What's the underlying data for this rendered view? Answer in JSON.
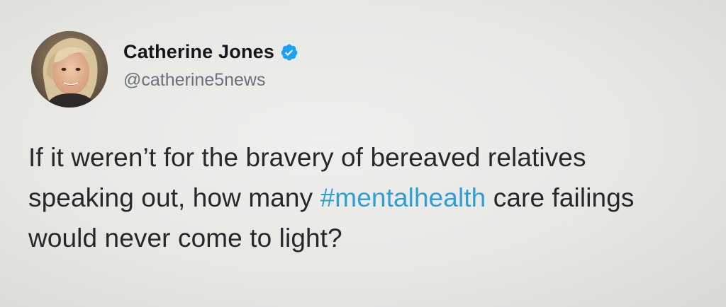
{
  "tweet": {
    "author": {
      "display_name": "Catherine Jones",
      "handle": "@catherine5news",
      "verified": true,
      "avatar_icon": "profile-photo-icon",
      "verified_icon": "verified-badge-icon"
    },
    "text_lines": [
      {
        "before": "If it weren’t for the bravery of bereaved relatives",
        "hashtag": "",
        "after": ""
      },
      {
        "before": "speaking out, how many ",
        "hashtag": "#mentalhealth",
        "after": " care failings"
      },
      {
        "before": "would never come to light?",
        "hashtag": "",
        "after": ""
      }
    ]
  },
  "colors": {
    "hashtag": "#2f9fd6",
    "verified_badge": "#1da1f2",
    "name": "#141619",
    "handle": "#6b7178",
    "body_text": "#26282b"
  }
}
